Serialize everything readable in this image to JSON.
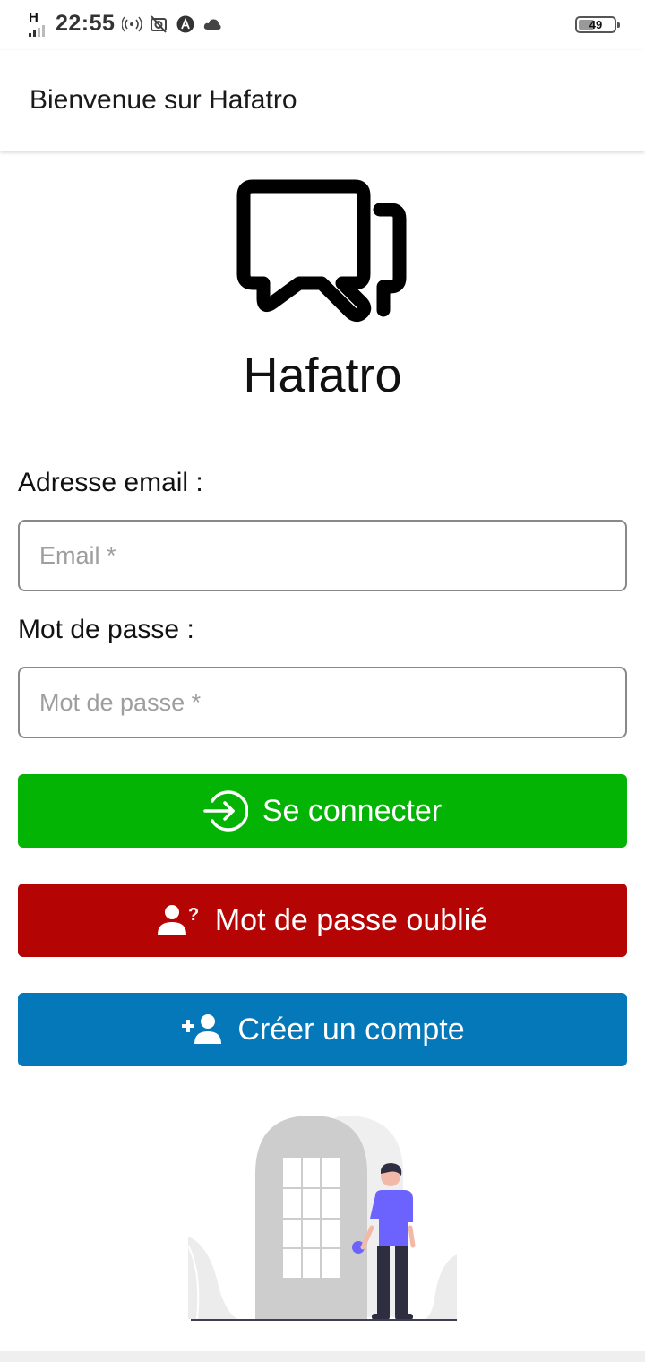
{
  "status_bar": {
    "network": "H",
    "time": "22:55",
    "battery": "49",
    "battery_level": 0.49
  },
  "app_bar": {
    "title": "Bienvenue sur Hafatro"
  },
  "brand": {
    "name": "Hafatro"
  },
  "form": {
    "email_label": "Adresse email :",
    "email_placeholder": "Email *",
    "email_value": "",
    "password_label": "Mot de passe :",
    "password_placeholder": "Mot de passe *",
    "password_value": ""
  },
  "buttons": {
    "login": "Se connecter",
    "forgot": "Mot de passe oublié",
    "register": "Créer un compte"
  },
  "icons": {
    "logo": "chat-bubbles-icon",
    "login": "login-arrow-icon",
    "forgot": "user-question-icon",
    "register": "user-add-icon"
  },
  "colors": {
    "login": "#04b404",
    "forgot": "#b40404",
    "register": "#0478b8",
    "person_shirt": "#6c63ff"
  }
}
